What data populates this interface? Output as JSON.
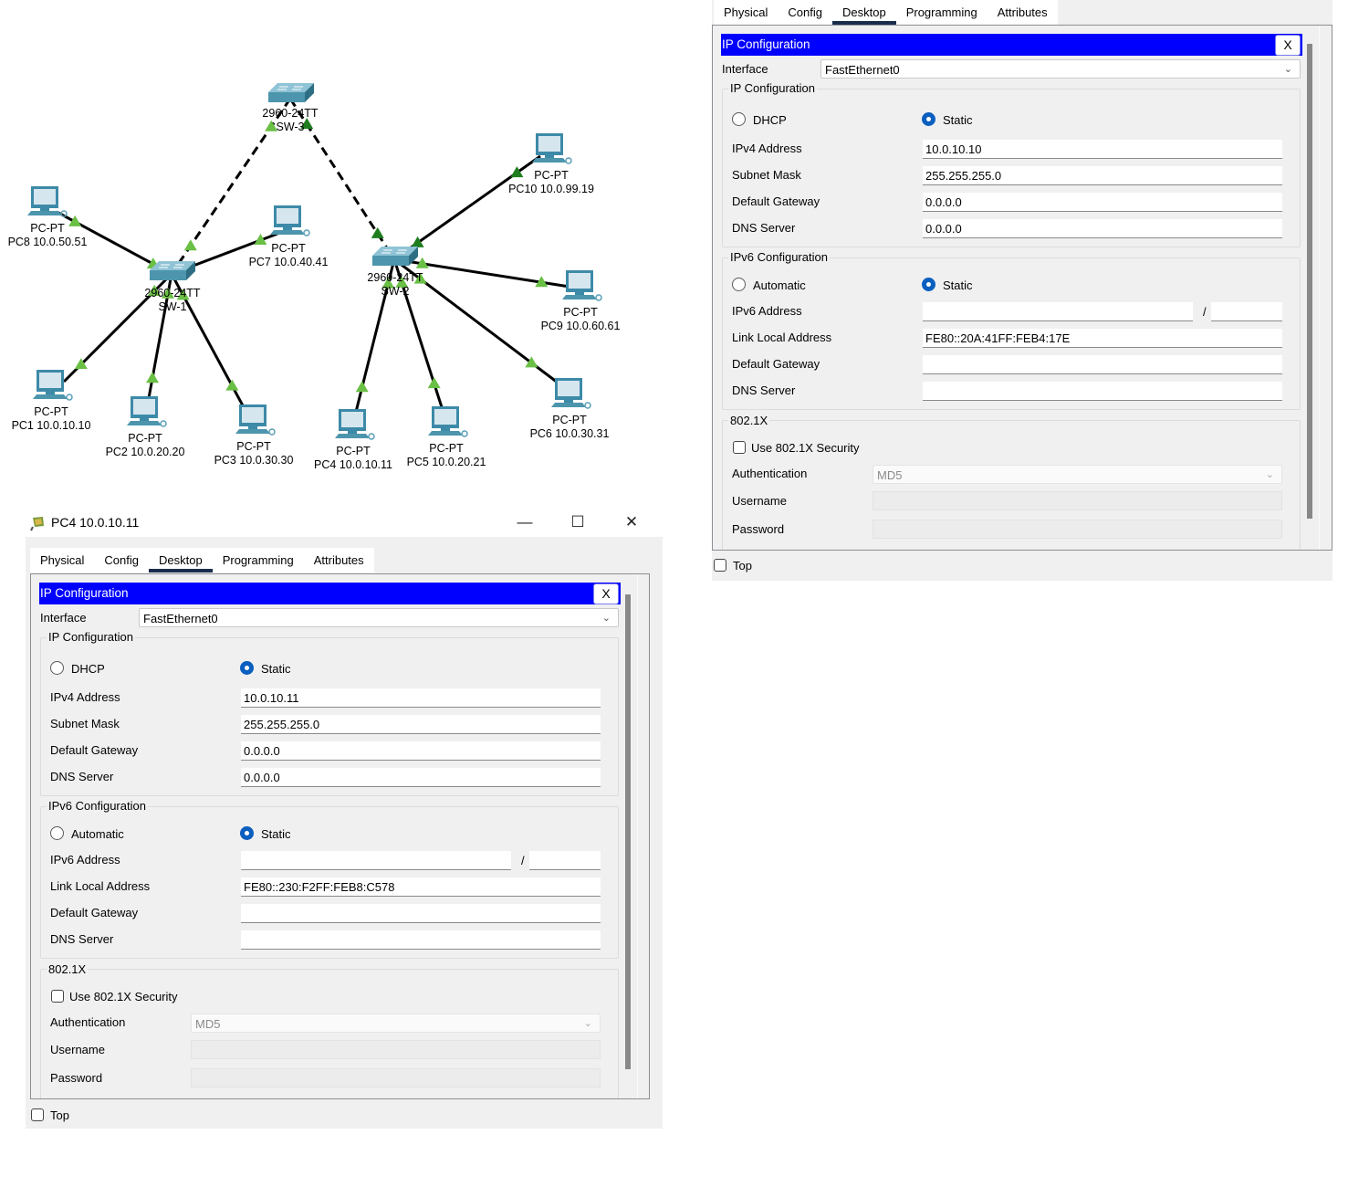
{
  "topology": {
    "switches": [
      {
        "id": "SW-3",
        "model": "2960-24TT",
        "name": "SW-3"
      },
      {
        "id": "SW-1",
        "model": "2960-24TT",
        "name": "SW-1"
      },
      {
        "id": "SW-2",
        "model": "2960-24TT",
        "name": "SW-2"
      }
    ],
    "pcs": [
      {
        "id": "PC8",
        "type": "PC-PT",
        "label": "PC8 10.0.50.51"
      },
      {
        "id": "PC7",
        "type": "PC-PT",
        "label": "PC7 10.0.40.41"
      },
      {
        "id": "PC1",
        "type": "PC-PT",
        "label": "PC1 10.0.10.10"
      },
      {
        "id": "PC2",
        "type": "PC-PT",
        "label": "PC2 10.0.20.20"
      },
      {
        "id": "PC3",
        "type": "PC-PT",
        "label": "PC3 10.0.30.30"
      },
      {
        "id": "PC10",
        "type": "PC-PT",
        "label": "PC10 10.0.99.19"
      },
      {
        "id": "PC9",
        "type": "PC-PT",
        "label": "PC9 10.0.60.61"
      },
      {
        "id": "PC4",
        "type": "PC-PT",
        "label": "PC4 10.0.10.11"
      },
      {
        "id": "PC5",
        "type": "PC-PT",
        "label": "PC5 10.0.20.21"
      },
      {
        "id": "PC6",
        "type": "PC-PT",
        "label": "PC6 10.0.30.31"
      }
    ],
    "links": [
      {
        "from": "SW-3",
        "to": "SW-1",
        "style": "crossover"
      },
      {
        "from": "SW-3",
        "to": "SW-2",
        "style": "crossover"
      },
      {
        "from": "SW-1",
        "to": "PC8",
        "style": "straight"
      },
      {
        "from": "SW-1",
        "to": "PC7",
        "style": "straight"
      },
      {
        "from": "SW-1",
        "to": "PC1",
        "style": "straight"
      },
      {
        "from": "SW-1",
        "to": "PC2",
        "style": "straight"
      },
      {
        "from": "SW-1",
        "to": "PC3",
        "style": "straight"
      },
      {
        "from": "SW-2",
        "to": "PC10",
        "style": "straight"
      },
      {
        "from": "SW-2",
        "to": "PC9",
        "style": "straight"
      },
      {
        "from": "SW-2",
        "to": "PC4",
        "style": "straight"
      },
      {
        "from": "SW-2",
        "to": "PC5",
        "style": "straight"
      },
      {
        "from": "SW-2",
        "to": "PC6",
        "style": "straight"
      }
    ],
    "link_status_color": "#6abf45",
    "link_status_dark_color": "#1e7d1e"
  },
  "panel_right": {
    "tabs": [
      "Physical",
      "Config",
      "Desktop",
      "Programming",
      "Attributes"
    ],
    "active_tab": "Desktop",
    "titlebar": "IP Configuration",
    "close_label": "X",
    "interface_label": "Interface",
    "interface_value": "FastEthernet0",
    "ipv4_group": "IP Configuration",
    "dhcp_label": "DHCP",
    "static_label": "Static",
    "ipv4_mode": "Static",
    "ipv4_address_label": "IPv4 Address",
    "ipv4_address": "10.0.10.10",
    "subnet_label": "Subnet Mask",
    "subnet": "255.255.255.0",
    "gateway_label": "Default Gateway",
    "gateway": "0.0.0.0",
    "dns_label": "DNS Server",
    "dns": "0.0.0.0",
    "ipv6_group": "IPv6 Configuration",
    "auto_label": "Automatic",
    "static6_label": "Static",
    "ipv6_mode": "Static",
    "ipv6_address_label": "IPv6 Address",
    "ipv6_address": "",
    "ipv6_prefix": "",
    "prefix_sep": "/",
    "link_local_label": "Link Local Address",
    "link_local": "FE80::20A:41FF:FEB4:17E",
    "gateway6_label": "Default Gateway",
    "gateway6": "",
    "dns6_label": "DNS Server",
    "dns6": "",
    "dot1x_group": "802.1X",
    "use_dot1x_label": "Use 802.1X Security",
    "use_dot1x": false,
    "auth_label": "Authentication",
    "auth_value": "MD5",
    "username_label": "Username",
    "username": "",
    "password_label": "Password",
    "password": "",
    "top_label": "Top",
    "top_checked": false
  },
  "panel_pc4": {
    "window_title": "PC4 10.0.10.11",
    "minimize": "—",
    "maximize": "☐",
    "close": "✕",
    "tabs": [
      "Physical",
      "Config",
      "Desktop",
      "Programming",
      "Attributes"
    ],
    "active_tab": "Desktop",
    "titlebar": "IP Configuration",
    "close_label": "X",
    "interface_label": "Interface",
    "interface_value": "FastEthernet0",
    "ipv4_group": "IP Configuration",
    "dhcp_label": "DHCP",
    "static_label": "Static",
    "ipv4_mode": "Static",
    "ipv4_address_label": "IPv4 Address",
    "ipv4_address": "10.0.10.11",
    "subnet_label": "Subnet Mask",
    "subnet": "255.255.255.0",
    "gateway_label": "Default Gateway",
    "gateway": "0.0.0.0",
    "dns_label": "DNS Server",
    "dns": "0.0.0.0",
    "ipv6_group": "IPv6 Configuration",
    "auto_label": "Automatic",
    "static6_label": "Static",
    "ipv6_mode": "Static",
    "ipv6_address_label": "IPv6 Address",
    "ipv6_address": "",
    "ipv6_prefix": "",
    "prefix_sep": "/",
    "link_local_label": "Link Local Address",
    "link_local": "FE80::230:F2FF:FEB8:C578",
    "gateway6_label": "Default Gateway",
    "gateway6": "",
    "dns6_label": "DNS Server",
    "dns6": "",
    "dot1x_group": "802.1X",
    "use_dot1x_label": "Use 802.1X Security",
    "use_dot1x": false,
    "auth_label": "Authentication",
    "auth_value": "MD5",
    "username_label": "Username",
    "username": "",
    "password_label": "Password",
    "password": "",
    "top_label": "Top",
    "top_checked": false
  }
}
